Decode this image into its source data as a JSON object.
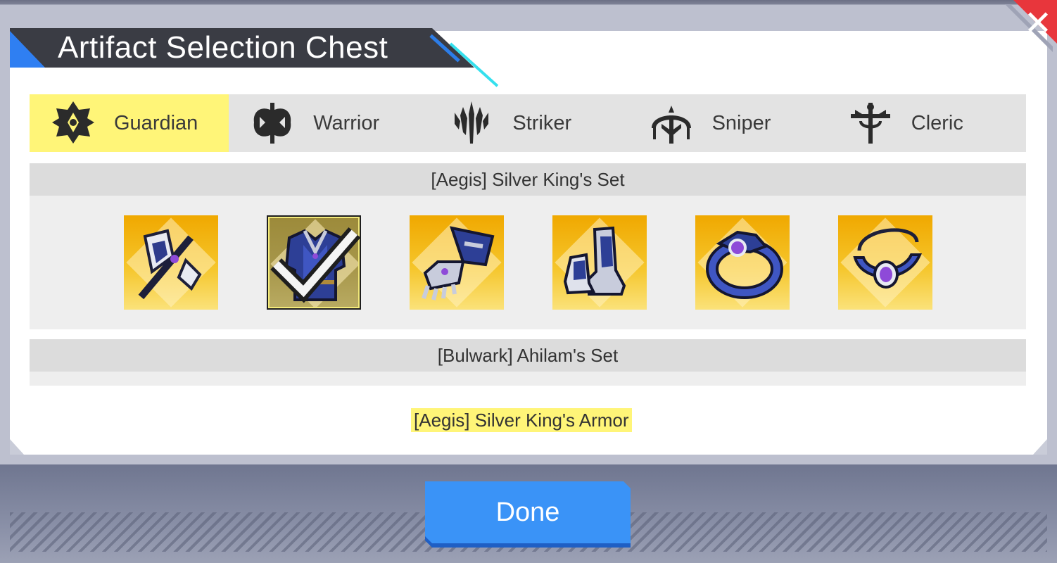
{
  "title": "Artifact Selection Chest",
  "close_icon": "close-icon",
  "tabs": [
    {
      "label": "Guardian",
      "icon": "guardian-class-icon",
      "active": true
    },
    {
      "label": "Warrior",
      "icon": "warrior-class-icon",
      "active": false
    },
    {
      "label": "Striker",
      "icon": "striker-class-icon",
      "active": false
    },
    {
      "label": "Sniper",
      "icon": "sniper-class-icon",
      "active": false
    },
    {
      "label": "Cleric",
      "icon": "cleric-class-icon",
      "active": false
    }
  ],
  "sets": [
    {
      "name": "[Aegis] Silver King's Set",
      "items": [
        {
          "icon": "axe-weapon-icon",
          "selected": false
        },
        {
          "icon": "armor-icon",
          "selected": true
        },
        {
          "icon": "gauntlet-icon",
          "selected": false
        },
        {
          "icon": "boots-icon",
          "selected": false
        },
        {
          "icon": "ring-icon",
          "selected": false
        },
        {
          "icon": "necklace-icon",
          "selected": false
        }
      ]
    },
    {
      "name": "[Bulwark] Ahilam's Set",
      "items": []
    }
  ],
  "selected_item_name": "[Aegis] Silver King's Armor",
  "done_label": "Done",
  "colors": {
    "active_tab": "#fff578",
    "done_button": "#3a93f7",
    "close_button": "#e8363c",
    "item_background": "#f5c52a",
    "title_banner": "#3a3c44"
  }
}
